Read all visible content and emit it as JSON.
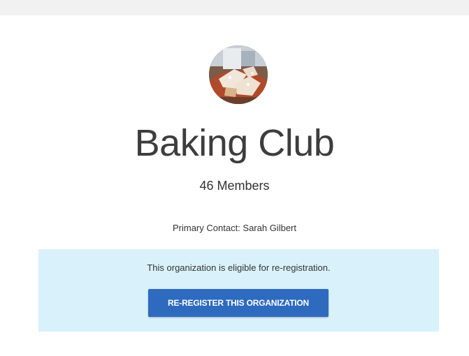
{
  "organization": {
    "name": "Baking Club",
    "members_label": "46 Members",
    "primary_contact_label": "Primary Contact: Sarah Gilbert",
    "avatar_icon": "pastry-photo"
  },
  "reregistration": {
    "message": "This organization is eligible for re-registration.",
    "button_label": "RE-REGISTER THIS ORGANIZATION"
  },
  "colors": {
    "notice_background": "#d9f1fb",
    "button_background": "#2e6bbf",
    "top_band": "#f1f1f1"
  }
}
